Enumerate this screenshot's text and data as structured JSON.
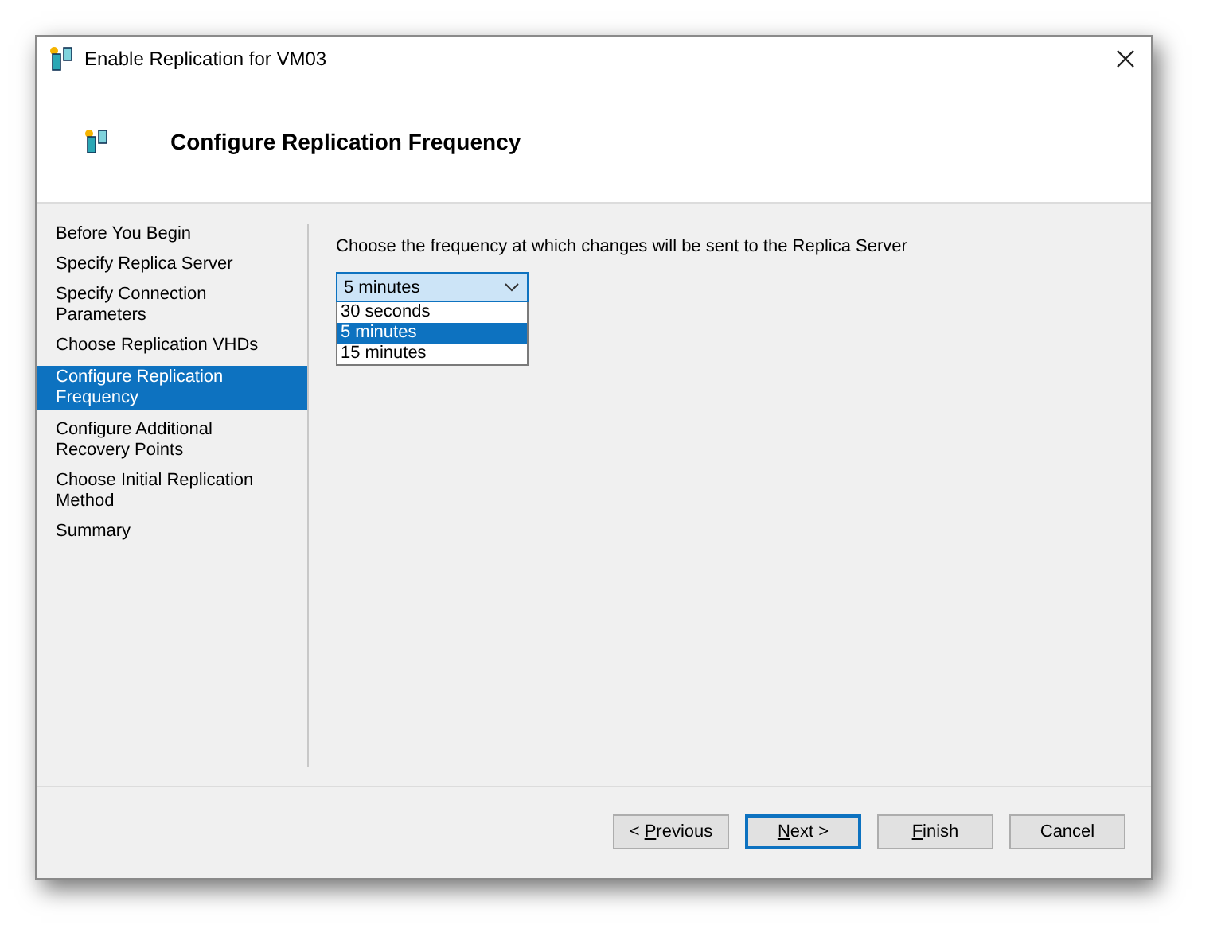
{
  "window": {
    "title": "Enable Replication for VM03"
  },
  "header": {
    "title": "Configure Replication Frequency"
  },
  "steps": [
    {
      "label": "Before You Begin",
      "selected": false
    },
    {
      "label": "Specify Replica Server",
      "selected": false
    },
    {
      "label": "Specify Connection Parameters",
      "selected": false
    },
    {
      "label": "Choose Replication VHDs",
      "selected": false
    },
    {
      "label": "Configure Replication Frequency",
      "selected": true
    },
    {
      "label": "Configure Additional Recovery Points",
      "selected": false
    },
    {
      "label": "Choose Initial Replication Method",
      "selected": false
    },
    {
      "label": "Summary",
      "selected": false
    }
  ],
  "instruction": "Choose the frequency at which changes will be sent to the Replica Server",
  "frequency": {
    "value": "5 minutes",
    "expanded": true,
    "options": [
      {
        "label": "30 seconds",
        "selected": false
      },
      {
        "label": "5 minutes",
        "selected": true
      },
      {
        "label": "15 minutes",
        "selected": false
      }
    ]
  },
  "buttons": [
    {
      "before": "< ",
      "key": "P",
      "after": "revious",
      "default": false
    },
    {
      "key": "N",
      "after": "ext >",
      "default": true
    },
    {
      "key": "F",
      "after": "inish",
      "default": false
    },
    {
      "before": "Cancel",
      "default": false
    }
  ]
}
